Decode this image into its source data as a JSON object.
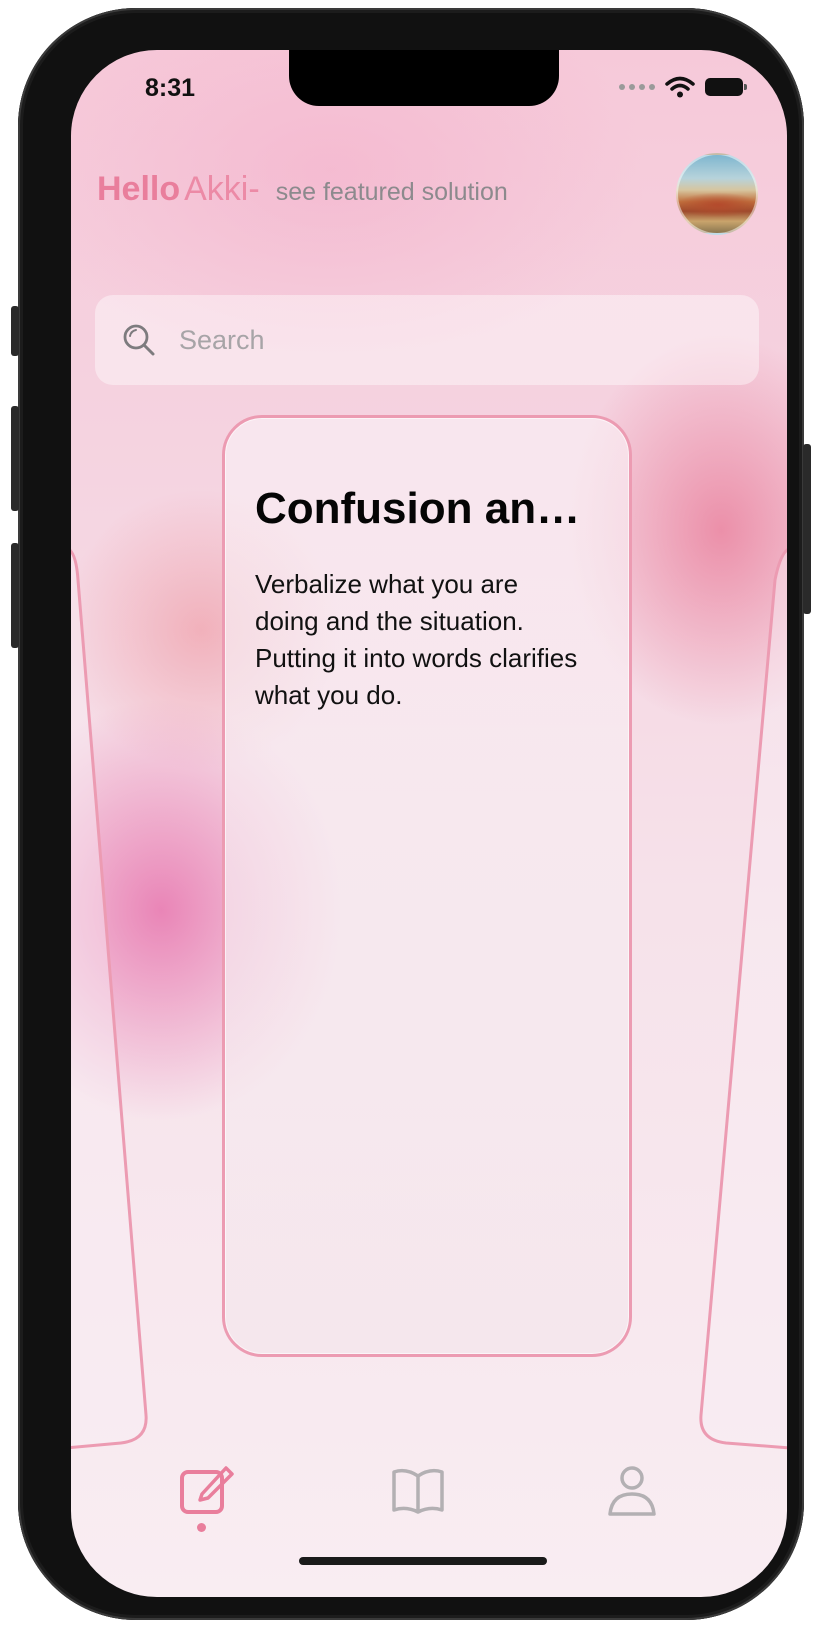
{
  "status_bar": {
    "time": "8:31",
    "icons": [
      "signal-dots-icon",
      "wifi-icon",
      "battery-icon"
    ]
  },
  "header": {
    "hello": "Hello",
    "name": "Akki-",
    "subtitle": "see featured solution",
    "avatar_icon": "avatar-landscape-photo"
  },
  "search": {
    "placeholder": "Search",
    "icon": "search-icon"
  },
  "card": {
    "title": "Confusion an…",
    "body": "Verbalize what you are doing and the situation. Putting it into words clarifies what you do."
  },
  "tab_bar": {
    "tabs": [
      {
        "icon": "compose-icon",
        "selected": true
      },
      {
        "icon": "book-icon",
        "selected": false
      },
      {
        "icon": "person-icon",
        "selected": false
      }
    ]
  },
  "colors": {
    "accent": "#e97e9c",
    "card_border": "#ec9bb2",
    "muted_text": "#8c8a8d",
    "inactive_icon": "#b3b0b3"
  }
}
